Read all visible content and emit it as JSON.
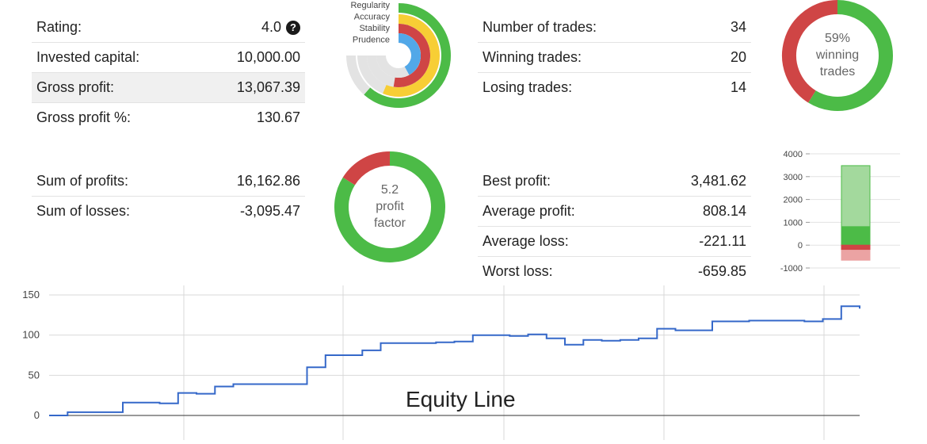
{
  "stats_left_top": [
    {
      "label": "Rating:",
      "value": "4.0",
      "icon": "question-circle-icon"
    },
    {
      "label": "Invested capital:",
      "value": "10,000.00"
    },
    {
      "label": "Gross profit:",
      "value": "13,067.39"
    },
    {
      "label": "Gross profit %:",
      "value": "130.67"
    }
  ],
  "stats_left_bottom": [
    {
      "label": "Sum of profits:",
      "value": "16,162.86"
    },
    {
      "label": "Sum of losses:",
      "value": "-3,095.47"
    }
  ],
  "stats_right_top": [
    {
      "label": "Number of trades:",
      "value": "34"
    },
    {
      "label": "Winning trades:",
      "value": "20"
    },
    {
      "label": "Losing trades:",
      "value": "14"
    }
  ],
  "stats_right_bottom": [
    {
      "label": "Best profit:",
      "value": "3,481.62"
    },
    {
      "label": "Average profit:",
      "value": "808.14"
    },
    {
      "label": "Average loss:",
      "value": "-221.11"
    },
    {
      "label": "Worst loss:",
      "value": "-659.85"
    }
  ],
  "colors": {
    "green": "#4cbb47",
    "red": "#cf4545",
    "yellow": "#f7ce35",
    "blue": "#52a8e8",
    "grey": "#e3e3e3",
    "light_green": "#a3d99d",
    "light_red": "#eba3a3",
    "line": "#3568c9"
  },
  "chart_data": [
    {
      "type": "radial-bar",
      "categories": [
        "Regularity",
        "Accuracy",
        "Stability",
        "Prudence"
      ],
      "values": [
        0.82,
        0.75,
        0.7,
        0.56
      ],
      "colors": [
        "#4cbb47",
        "#f7ce35",
        "#cf4545",
        "#52a8e8"
      ]
    },
    {
      "type": "pie",
      "variant": "donut",
      "labels": [
        "winning",
        "losing"
      ],
      "values": [
        20,
        14
      ],
      "center_text": [
        "59%",
        "winning",
        "trades"
      ]
    },
    {
      "type": "pie",
      "variant": "donut",
      "labels": [
        "profits",
        "losses"
      ],
      "values": [
        16162.86,
        3095.47
      ],
      "center_text": [
        "5.2",
        "profit",
        "factor"
      ]
    },
    {
      "type": "bar",
      "variant": "stacked",
      "segments": [
        {
          "name": "Best profit",
          "from": 808.14,
          "to": 3481.62,
          "color": "#a3d99d"
        },
        {
          "name": "Average profit",
          "from": 0,
          "to": 808.14,
          "color": "#4cbb47"
        },
        {
          "name": "Average loss",
          "from": -221.11,
          "to": 0,
          "color": "#cf4545"
        },
        {
          "name": "Worst loss",
          "from": -659.85,
          "to": -221.11,
          "color": "#eba3a3"
        }
      ],
      "yticks": [
        "4000",
        "3000",
        "2000",
        "1000",
        "0",
        "-1000"
      ],
      "ylim": [
        -1000,
        4000
      ]
    },
    {
      "type": "line",
      "title": "Equity Line",
      "yticks": [
        "150",
        "100",
        "50",
        "0"
      ],
      "ylim": [
        0,
        150
      ],
      "x": [
        0,
        1,
        2,
        3,
        4,
        5,
        6,
        7,
        8,
        9,
        10,
        11,
        12,
        13,
        14,
        15,
        16,
        17,
        18,
        19,
        20,
        21,
        22,
        23,
        24,
        25,
        26,
        27,
        28,
        29,
        30,
        31,
        32,
        33,
        34,
        35,
        36,
        37,
        38,
        39,
        40,
        41,
        42,
        43,
        44
      ],
      "y": [
        0,
        4,
        4,
        4,
        16,
        16,
        15,
        28,
        27,
        36,
        39,
        39,
        39,
        39,
        60,
        75,
        75,
        81,
        90,
        90,
        90,
        91,
        92,
        100,
        100,
        99,
        101,
        96,
        88,
        94,
        93,
        94,
        96,
        108,
        106,
        106,
        117,
        117,
        118,
        118,
        118,
        117,
        120,
        136,
        133
      ]
    }
  ]
}
